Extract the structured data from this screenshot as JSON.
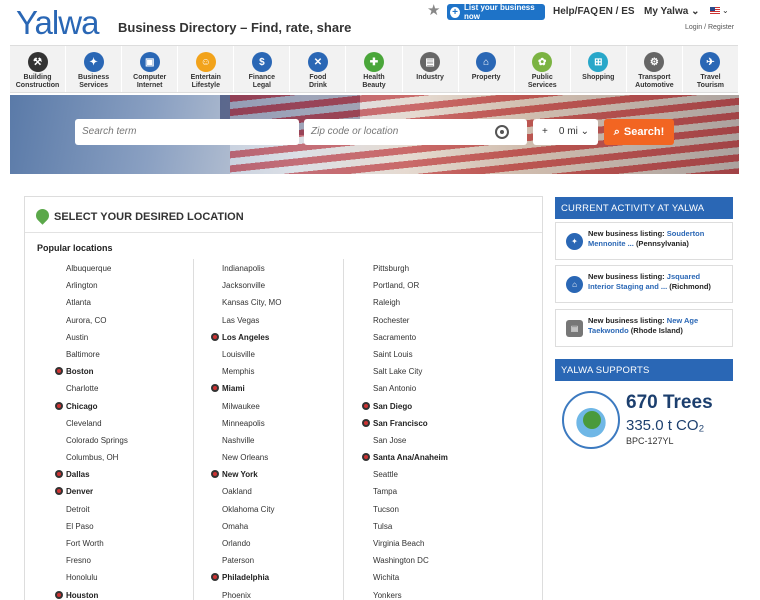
{
  "header": {
    "logo": "Yalwa",
    "tagline": "Business Directory – Find, rate, share",
    "list_button": "List your business now",
    "help": "Help/FAQ",
    "lang": "EN / ES",
    "my_yalwa": "My Yalwa",
    "login": "Login / Register"
  },
  "categories": [
    {
      "label": "Building\nConstruction",
      "icon": "crane-icon",
      "color": "#333333",
      "glyph": "⚒"
    },
    {
      "label": "Business\nServices",
      "icon": "handshake-icon",
      "color": "#2a67b5",
      "glyph": "✦"
    },
    {
      "label": "Computer\nInternet",
      "icon": "monitor-icon",
      "color": "#2a67b5",
      "glyph": "▣"
    },
    {
      "label": "Entertain\nLifestyle",
      "icon": "smiley-icon",
      "color": "#f2a31b",
      "glyph": "☺"
    },
    {
      "label": "Finance\nLegal",
      "icon": "money-icon",
      "color": "#2a67b5",
      "glyph": "$"
    },
    {
      "label": "Food\nDrink",
      "icon": "cutlery-icon",
      "color": "#2a67b5",
      "glyph": "✕"
    },
    {
      "label": "Health\nBeauty",
      "icon": "health-icon",
      "color": "#4aa63a",
      "glyph": "✚"
    },
    {
      "label": "Industry",
      "icon": "factory-icon",
      "color": "#666666",
      "glyph": "▤"
    },
    {
      "label": "Property",
      "icon": "house-icon",
      "color": "#2a67b5",
      "glyph": "⌂"
    },
    {
      "label": "Public\nServices",
      "icon": "community-icon",
      "color": "#7bb342",
      "glyph": "✿"
    },
    {
      "label": "Shopping",
      "icon": "cart-icon",
      "color": "#28a7c9",
      "glyph": "⊞"
    },
    {
      "label": "Transport\nAutomotive",
      "icon": "car-icon",
      "color": "#666666",
      "glyph": "⚙"
    },
    {
      "label": "Travel\nTourism",
      "icon": "plane-icon",
      "color": "#2a67b5",
      "glyph": "✈"
    }
  ],
  "search": {
    "term_placeholder": "Search term",
    "zip_placeholder": "Zip code or location",
    "radius_prefix": "+",
    "radius_value": "0 mi",
    "button": "Search!"
  },
  "locations": {
    "title": "SELECT YOUR DESIRED LOCATION",
    "popular_label": "Popular locations",
    "columns": [
      [
        {
          "name": "Albuquerque",
          "major": false
        },
        {
          "name": "Arlington",
          "major": false
        },
        {
          "name": "Atlanta",
          "major": false
        },
        {
          "name": "Aurora, CO",
          "major": false
        },
        {
          "name": "Austin",
          "major": false
        },
        {
          "name": "Baltimore",
          "major": false
        },
        {
          "name": "Boston",
          "major": true
        },
        {
          "name": "Charlotte",
          "major": false
        },
        {
          "name": "Chicago",
          "major": true
        },
        {
          "name": "Cleveland",
          "major": false
        },
        {
          "name": "Colorado Springs",
          "major": false
        },
        {
          "name": "Columbus, OH",
          "major": false
        },
        {
          "name": "Dallas",
          "major": true
        },
        {
          "name": "Denver",
          "major": true
        },
        {
          "name": "Detroit",
          "major": false
        },
        {
          "name": "El Paso",
          "major": false
        },
        {
          "name": "Fort Worth",
          "major": false
        },
        {
          "name": "Fresno",
          "major": false
        },
        {
          "name": "Honolulu",
          "major": false
        },
        {
          "name": "Houston",
          "major": true
        }
      ],
      [
        {
          "name": "Indianapolis",
          "major": false
        },
        {
          "name": "Jacksonville",
          "major": false
        },
        {
          "name": "Kansas City, MO",
          "major": false
        },
        {
          "name": "Las Vegas",
          "major": false
        },
        {
          "name": "Los Angeles",
          "major": true
        },
        {
          "name": "Louisville",
          "major": false
        },
        {
          "name": "Memphis",
          "major": false
        },
        {
          "name": "Miami",
          "major": true
        },
        {
          "name": "Milwaukee",
          "major": false
        },
        {
          "name": "Minneapolis",
          "major": false
        },
        {
          "name": "Nashville",
          "major": false
        },
        {
          "name": "New Orleans",
          "major": false
        },
        {
          "name": "New York",
          "major": true
        },
        {
          "name": "Oakland",
          "major": false
        },
        {
          "name": "Oklahoma City",
          "major": false
        },
        {
          "name": "Omaha",
          "major": false
        },
        {
          "name": "Orlando",
          "major": false
        },
        {
          "name": "Paterson",
          "major": false
        },
        {
          "name": "Philadelphia",
          "major": true
        },
        {
          "name": "Phoenix",
          "major": false
        }
      ],
      [
        {
          "name": "Pittsburgh",
          "major": false
        },
        {
          "name": "Portland, OR",
          "major": false
        },
        {
          "name": "Raleigh",
          "major": false
        },
        {
          "name": "Rochester",
          "major": false
        },
        {
          "name": "Sacramento",
          "major": false
        },
        {
          "name": "Saint Louis",
          "major": false
        },
        {
          "name": "Salt Lake City",
          "major": false
        },
        {
          "name": "San Antonio",
          "major": false
        },
        {
          "name": "San Diego",
          "major": true
        },
        {
          "name": "San Francisco",
          "major": true
        },
        {
          "name": "San Jose",
          "major": false
        },
        {
          "name": "Santa Ana/Anaheim",
          "major": true
        },
        {
          "name": "Seattle",
          "major": false
        },
        {
          "name": "Tampa",
          "major": false
        },
        {
          "name": "Tucson",
          "major": false
        },
        {
          "name": "Tulsa",
          "major": false
        },
        {
          "name": "Virginia Beach",
          "major": false
        },
        {
          "name": "Washington DC",
          "major": false
        },
        {
          "name": "Wichita",
          "major": false
        },
        {
          "name": "Yonkers",
          "major": false
        }
      ]
    ]
  },
  "activity": {
    "title": "CURRENT ACTIVITY AT YALWA",
    "items": [
      {
        "prefix": "New business listing:",
        "link": "Souderton Mennonite ...",
        "place": "(Pennsylvania)",
        "icon": "handshake-icon"
      },
      {
        "prefix": "New business listing:",
        "link": "Jsquared Interior Staging and ...",
        "place": "(Richmond)",
        "icon": "house-icon"
      },
      {
        "prefix": "New business listing:",
        "link": "New Age Taekwondo",
        "place": "(Rhode Island)",
        "icon": "factory-icon"
      }
    ]
  },
  "supports": {
    "title": "YALWA SUPPORTS",
    "trees": "670 Trees",
    "co2": "335.0 t CO₂",
    "code": "BPC-127YL"
  }
}
